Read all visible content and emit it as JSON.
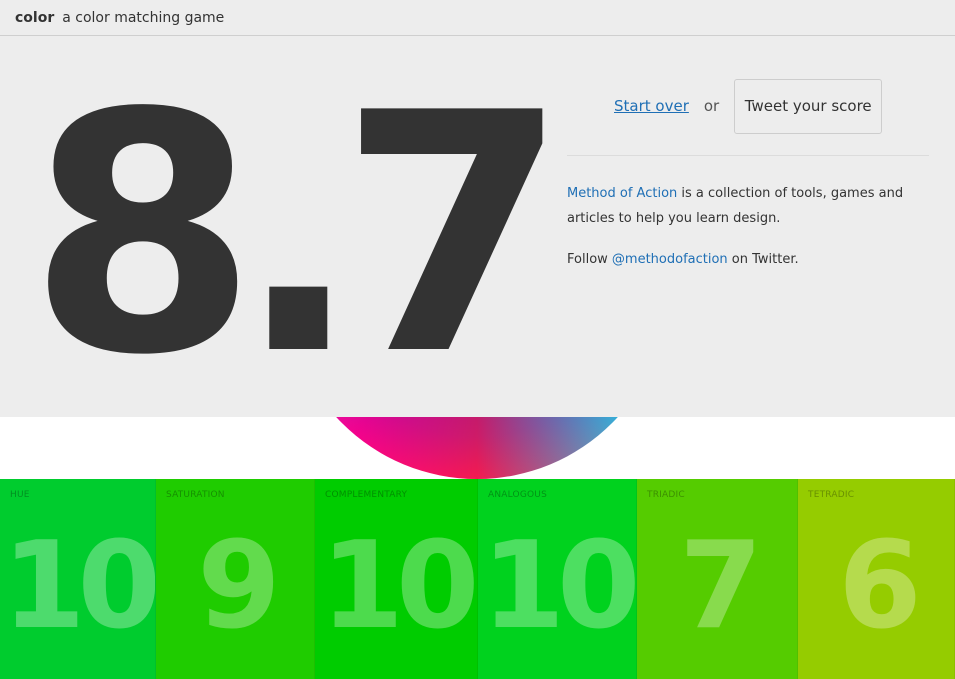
{
  "header": {
    "brand": "color",
    "tagline": "a color matching game"
  },
  "result": {
    "score": "8.7",
    "start_over_label": "Start over",
    "or_label": "or",
    "tweet_label": "Tweet your score"
  },
  "about": {
    "link_method": "Method of Action",
    "text_collection": " is a collection of tools, games and articles to help you learn design.",
    "follow_prefix": "Follow ",
    "link_twitter": "@methodofaction",
    "follow_suffix": " on Twitter."
  },
  "categories": [
    {
      "label": "HUE",
      "score": "10",
      "color": "#00cc2e"
    },
    {
      "label": "SATURATION",
      "score": "9",
      "color": "#1fcc00"
    },
    {
      "label": "COMPLEMENTARY",
      "score": "10",
      "color": "#00cc00"
    },
    {
      "label": "ANALOGOUS",
      "score": "10",
      "color": "#00d21e"
    },
    {
      "label": "TRIADIC",
      "score": "7",
      "color": "#55cc00"
    },
    {
      "label": "TETRADIC",
      "score": "6",
      "color": "#95cc00"
    }
  ]
}
